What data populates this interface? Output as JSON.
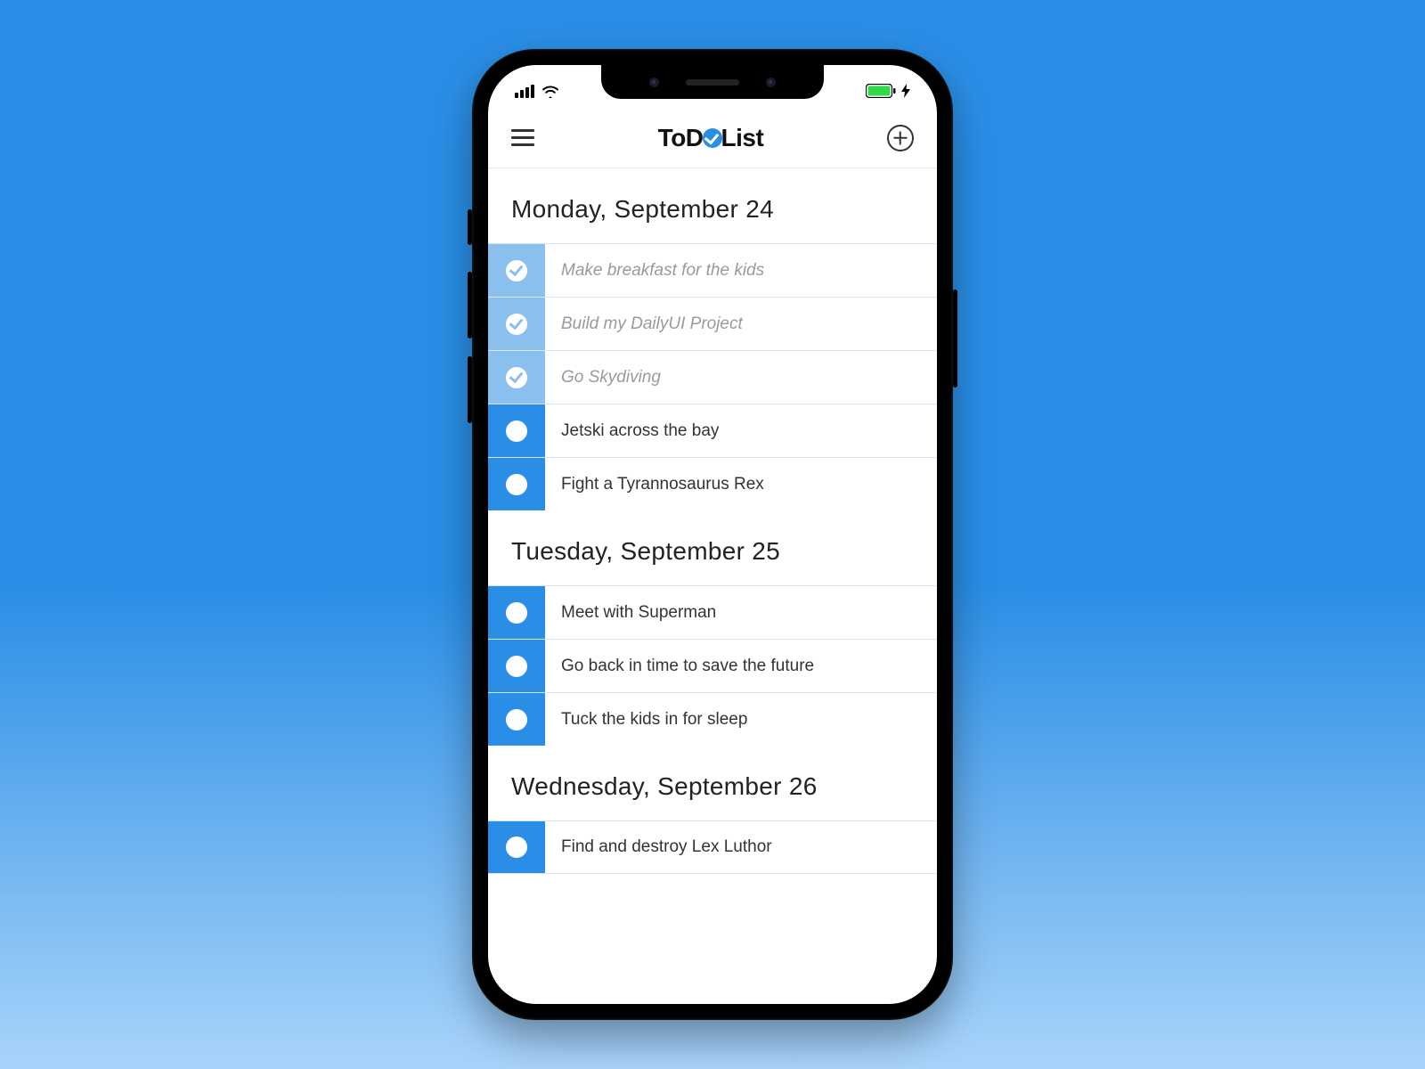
{
  "app": {
    "logo_prefix": "ToD",
    "logo_suffix": "List"
  },
  "colors": {
    "accent": "#2a8ee6",
    "accent_light": "#8abfee"
  },
  "days": [
    {
      "header": "Monday, September 24",
      "tasks": [
        {
          "label": "Make breakfast for the kids",
          "done": true
        },
        {
          "label": "Build my DailyUI Project",
          "done": true
        },
        {
          "label": "Go Skydiving",
          "done": true
        },
        {
          "label": "Jetski across the bay",
          "done": false
        },
        {
          "label": "Fight a Tyrannosaurus Rex",
          "done": false
        }
      ]
    },
    {
      "header": "Tuesday, September 25",
      "tasks": [
        {
          "label": "Meet with Superman",
          "done": false
        },
        {
          "label": "Go back in time to save the future",
          "done": false
        },
        {
          "label": "Tuck the kids in for sleep",
          "done": false
        }
      ]
    },
    {
      "header": "Wednesday, September 26",
      "tasks": [
        {
          "label": "Find and destroy Lex Luthor",
          "done": false
        }
      ]
    }
  ]
}
